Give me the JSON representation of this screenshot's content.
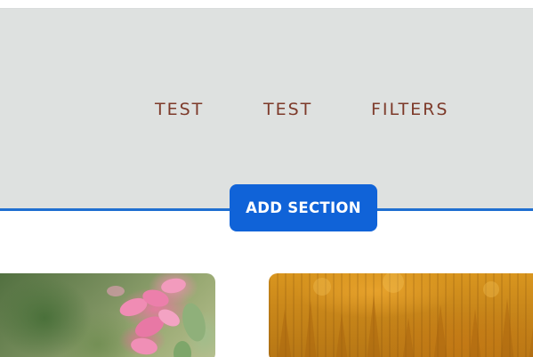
{
  "nav": {
    "items": [
      {
        "label": "TEST"
      },
      {
        "label": "TEST"
      },
      {
        "label": "FILTERS"
      }
    ]
  },
  "editor": {
    "add_section_label": "ADD SECTION"
  },
  "colors": {
    "header_background": "#dee1e0",
    "nav_text": "#7d3a2a",
    "accent_blue": "#1063d8",
    "section_line": "#1f6fd1"
  },
  "gallery": {
    "cards": [
      {
        "image": "pink-flower-photo"
      },
      {
        "image": "golden-forest-photo"
      }
    ]
  }
}
